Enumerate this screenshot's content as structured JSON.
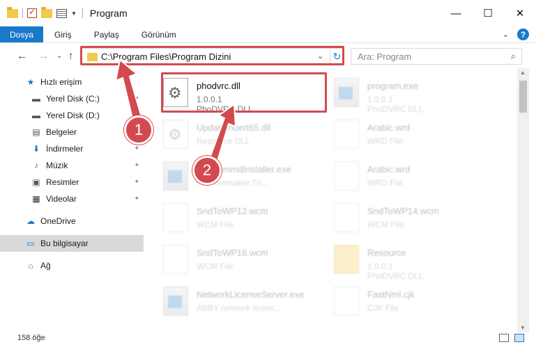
{
  "window": {
    "title": "Program",
    "minimize": "—",
    "maximize": "☐",
    "close": "✕"
  },
  "ribbon": {
    "tabs": [
      "Dosya",
      "Giriş",
      "Paylaş",
      "Görünüm"
    ],
    "expand_icon": "⌄",
    "help": "?"
  },
  "nav": {
    "back": "←",
    "forward": "→",
    "recent": "⌄",
    "up": "↑",
    "address": "C:\\Program Files\\Program Dizini",
    "dropdown": "⌄",
    "refresh": "↻",
    "search_placeholder": "Ara: Program",
    "search_icon": "⌕"
  },
  "sidebar": {
    "items": [
      {
        "label": "Hızlı erişim",
        "icon": "star-icon",
        "glyph": "★",
        "color": "#1979ca"
      },
      {
        "label": "Yerel Disk (C:)",
        "icon": "drive-icon",
        "glyph": "▬",
        "color": "#555555",
        "pinned": true
      },
      {
        "label": "Yerel Disk (D:)",
        "icon": "drive-icon",
        "glyph": "▬",
        "color": "#555555",
        "pinned": true
      },
      {
        "label": "Belgeler",
        "icon": "documents-icon",
        "glyph": "▤",
        "color": "#555555",
        "pinned": true
      },
      {
        "label": "İndirmeler",
        "icon": "download-icon",
        "glyph": "⬇",
        "color": "#1979ca",
        "pinned": true
      },
      {
        "label": "Müzik",
        "icon": "music-icon",
        "glyph": "♪",
        "color": "#1979ca",
        "pinned": true
      },
      {
        "label": "Resimler",
        "icon": "pictures-icon",
        "glyph": "▣",
        "color": "#555555",
        "pinned": true
      },
      {
        "label": "Videolar",
        "icon": "video-icon",
        "glyph": "▦",
        "color": "#333333",
        "pinned": true
      },
      {
        "label": "OneDrive",
        "icon": "cloud-icon",
        "glyph": "☁",
        "color": "#1979ca"
      },
      {
        "label": "Bu bilgisayar",
        "icon": "computer-icon",
        "glyph": "▭",
        "color": "#1979ca",
        "selected": true
      },
      {
        "label": "Ağ",
        "icon": "network-icon",
        "glyph": "⌂",
        "color": "#1979ca"
      }
    ],
    "pin_glyph": "📌"
  },
  "files": [
    {
      "name": "phodvrc.dll",
      "line2": "1.0.0.1",
      "line3": "PhoDVRC DLL",
      "type": "dll",
      "highlight": true
    },
    {
      "name": "program.exe",
      "line2": "1.0.0.1",
      "line3": "PhoDVRC DLL",
      "type": "exe"
    },
    {
      "name": "UpdateInbert65.dll",
      "line2": "Resource DLL",
      "line3": "",
      "type": "dll"
    },
    {
      "name": "Arabic.wrd",
      "line2": "WRD File",
      "line3": "",
      "type": "doc"
    },
    {
      "name": "programmdInstaller.exe",
      "line2": "FF Freemaker Tri...",
      "line3": "",
      "type": "exe"
    },
    {
      "name": "Arabic.wrd",
      "line2": "WRD File",
      "line3": "",
      "type": "doc"
    },
    {
      "name": "SndToWP12.wcm",
      "line2": "WCM File",
      "line3": "",
      "type": "doc"
    },
    {
      "name": "SndToWP14.wcm",
      "line2": "WCM File",
      "line3": "",
      "type": "doc"
    },
    {
      "name": "SndToWP16.wcm",
      "line2": "WCM File",
      "line3": "",
      "type": "doc"
    },
    {
      "name": "Resource",
      "line2": "1.0.0.1",
      "line3": "PhoDVRC DLL",
      "type": "res"
    },
    {
      "name": "NetworkLicenseServer.exe",
      "line2": "ABBY network licens...",
      "line3": "",
      "type": "exe"
    },
    {
      "name": "FastNml.cjk",
      "line2": "CJK File",
      "line3": "",
      "type": "doc"
    }
  ],
  "status": {
    "item_count": "158 öğe"
  },
  "annotations": {
    "badge1": "1",
    "badge2": "2",
    "color": "#d24a4f"
  }
}
